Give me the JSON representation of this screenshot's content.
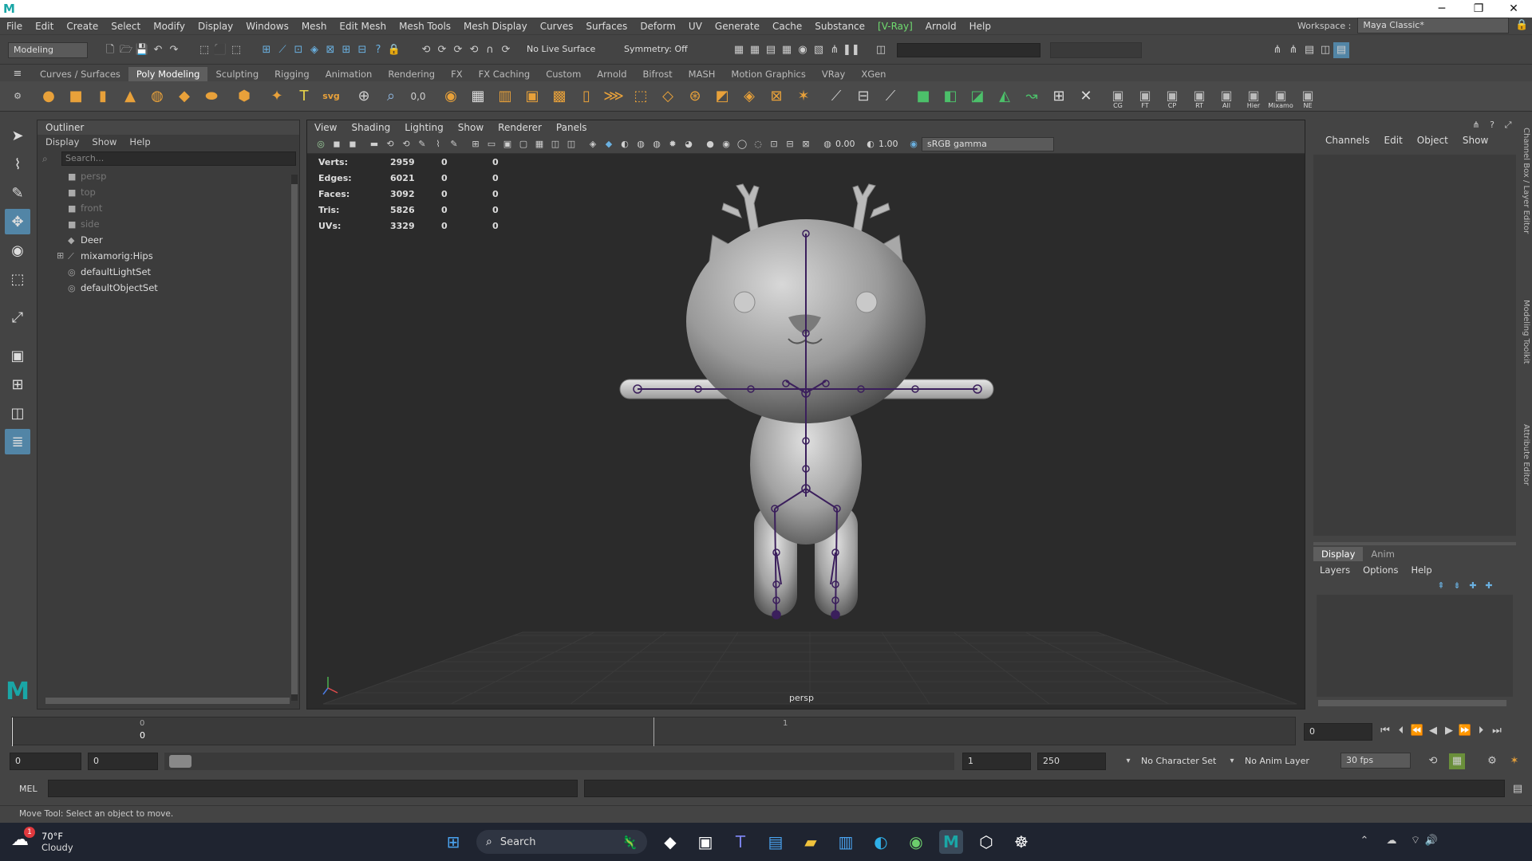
{
  "app": {
    "logo": "M"
  },
  "window": {
    "minimize": "─",
    "maximize": "❐",
    "close": "✕"
  },
  "menu": [
    "File",
    "Edit",
    "Create",
    "Select",
    "Modify",
    "Display",
    "Windows",
    "Mesh",
    "Edit Mesh",
    "Mesh Tools",
    "Mesh Display",
    "Curves",
    "Surfaces",
    "Deform",
    "UV",
    "Generate",
    "Cache",
    "Substance",
    "[V-Ray]",
    "Arnold",
    "Help"
  ],
  "workspace": {
    "label": "Workspace :",
    "value": "Maya Classic*"
  },
  "statusline": {
    "mode": "Modeling",
    "live_surface": "No Live Surface",
    "symmetry": "Symmetry: Off"
  },
  "shelf_tabs": [
    "Curves / Surfaces",
    "Poly Modeling",
    "Sculpting",
    "Rigging",
    "Animation",
    "Rendering",
    "FX",
    "FX Caching",
    "Custom",
    "Arnold",
    "Bifrost",
    "MASH",
    "Motion Graphics",
    "VRay",
    "XGen"
  ],
  "shelf_active": "Poly Modeling",
  "shelf_icons_right": [
    "CG",
    "FT",
    "CP",
    "RT",
    "All",
    "Hier",
    "Mixamo",
    "NE"
  ],
  "outliner": {
    "title": "Outliner",
    "menu": [
      "Display",
      "Show",
      "Help"
    ],
    "search_placeholder": "Search...",
    "items": [
      {
        "label": "persp",
        "dim": true,
        "icon": "camera-icon",
        "glyph": "■"
      },
      {
        "label": "top",
        "dim": true,
        "icon": "camera-icon",
        "glyph": "■"
      },
      {
        "label": "front",
        "dim": true,
        "icon": "camera-icon",
        "glyph": "■"
      },
      {
        "label": "side",
        "dim": true,
        "icon": "camera-icon",
        "glyph": "■"
      },
      {
        "label": "Deer",
        "dim": false,
        "icon": "mesh-icon",
        "glyph": "◆"
      },
      {
        "label": "mixamorig:Hips",
        "dim": false,
        "icon": "joint-icon",
        "glyph": "⟋",
        "expand": "⊞"
      },
      {
        "label": "defaultLightSet",
        "dim": false,
        "icon": "set-icon",
        "glyph": "◎"
      },
      {
        "label": "defaultObjectSet",
        "dim": false,
        "icon": "set-icon",
        "glyph": "◎"
      }
    ]
  },
  "viewport": {
    "menu": [
      "View",
      "Shading",
      "Lighting",
      "Show",
      "Renderer",
      "Panels"
    ],
    "exposure": "0.00",
    "gamma": "1.00",
    "colorspace": "sRGB gamma",
    "camera": "persp",
    "hud": [
      {
        "label": "Verts:",
        "v1": "2959",
        "v2": "0",
        "v3": "0"
      },
      {
        "label": "Edges:",
        "v1": "6021",
        "v2": "0",
        "v3": "0"
      },
      {
        "label": "Faces:",
        "v1": "3092",
        "v2": "0",
        "v3": "0"
      },
      {
        "label": "Tris:",
        "v1": "5826",
        "v2": "0",
        "v3": "0"
      },
      {
        "label": "UVs:",
        "v1": "3329",
        "v2": "0",
        "v3": "0"
      }
    ]
  },
  "channelbox": {
    "menu": [
      "Channels",
      "Edit",
      "Object",
      "Show"
    ],
    "tabs": [
      "Display",
      "Anim"
    ],
    "layer_menu": [
      "Layers",
      "Options",
      "Help"
    ],
    "side_tabs": [
      "Channel Box / Layer Editor",
      "Modeling Toolkit",
      "Attribute Editor"
    ]
  },
  "timeslider": {
    "start_label": "0",
    "current_label": "0",
    "marker": "1",
    "current_frame": "0"
  },
  "range": {
    "anim_start": "0",
    "play_start": "0",
    "play_end": "1",
    "anim_end": "250",
    "character_set": "No Character Set",
    "anim_layer": "No Anim Layer",
    "fps": "30 fps"
  },
  "cmd": {
    "label": "MEL"
  },
  "help": "Move Tool: Select an object to move.",
  "taskbar": {
    "temp": "70°F",
    "weather": "Cloudy",
    "badge": "1",
    "search": "Search"
  }
}
